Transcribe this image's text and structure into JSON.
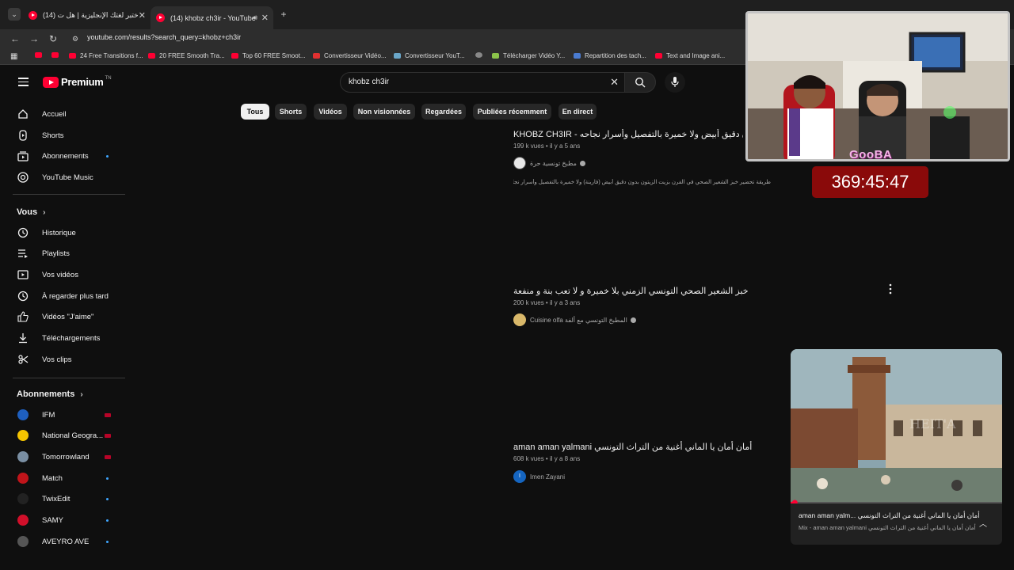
{
  "browser": {
    "tabs": [
      {
        "title": "(14) اختبر لغتك الإنجليزية | هل ت..."
      },
      {
        "title": "(14) khobz ch3ir - YouTube"
      }
    ],
    "url": "youtube.com/results?search_query=khobz+ch3ir",
    "bookmarks": [
      "24 Free Transitions f...",
      "20 FREE Smooth Tra...",
      "Top 60 FREE Smoot...",
      "Convertisseur Vidéo...",
      "Convertisseur YouT...",
      "Télécharger Vidéo Y...",
      "Repartition des tach...",
      "Text and Image ani..."
    ]
  },
  "youtube": {
    "logo_text": "Premium",
    "logo_badge": "TN",
    "search_value": "khobz ch3ir",
    "chips": [
      "Tous",
      "Shorts",
      "Vidéos",
      "Non visionnées",
      "Regardées",
      "Publiées récemment",
      "En direct"
    ],
    "active_chip": "Tous"
  },
  "sidebar": {
    "main": [
      {
        "label": "Accueil",
        "icon": "home-icon"
      },
      {
        "label": "Shorts",
        "icon": "shorts-icon"
      },
      {
        "label": "Abonnements",
        "icon": "subscriptions-icon"
      },
      {
        "label": "YouTube Music",
        "icon": "music-icon"
      }
    ],
    "vous_heading": "Vous",
    "vous": [
      {
        "label": "Historique",
        "icon": "history-icon"
      },
      {
        "label": "Playlists",
        "icon": "playlists-icon"
      },
      {
        "label": "Vos vidéos",
        "icon": "your-videos-icon"
      },
      {
        "label": "À regarder plus tard",
        "icon": "watch-later-icon"
      },
      {
        "label": "Vidéos \"J'aime\"",
        "icon": "like-icon"
      },
      {
        "label": "Téléchargements",
        "icon": "download-icon"
      },
      {
        "label": "Vos clips",
        "icon": "clips-icon"
      }
    ],
    "subs_heading": "Abonnements",
    "subs": [
      {
        "label": "IFM",
        "color": "#1e5fbf",
        "status": "live"
      },
      {
        "label": "National Geogra...",
        "color": "#f5c400",
        "status": "live"
      },
      {
        "label": "Tomorrowland",
        "color": "#7a8fa3",
        "status": "live"
      },
      {
        "label": "Match",
        "color": "#c0141a",
        "status": "new"
      },
      {
        "label": "TwixEdit",
        "color": "#222222",
        "status": "new"
      },
      {
        "label": "SAMY",
        "color": "#d10f2a",
        "status": "new"
      },
      {
        "label": "AVEYRO AVE",
        "color": "#555555",
        "status": "new"
      }
    ]
  },
  "results": [
    {
      "title": "KHOBZ CH3IR - خبز الشعير بدون دقيق أبيض ولا خميرة بالتفصيل وأسرار نجاحه",
      "views": "199 k vues",
      "age": "il y a 5 ans",
      "channel": "مطبخ تونسية حرة",
      "description": "طريقة تحضير خبز الشعير الصحي في الفرن بزيت الزيتون بدون دقيق أبيض (فارينة) ولا خميرة بالتفصيل وأسرار نجاحه ان ..."
    },
    {
      "title": "خبز الشعير الصحي التونسي الزمني بلا خميرة و لا تعب بنة و منفعة",
      "views": "200 k vues",
      "age": "il y a 3 ans",
      "channel": "Cuisine olfa المطبخ التونسي مع ألفة"
    },
    {
      "title": "aman aman yalmani أمان أمان يا الماني أغنية من التراث التونسي",
      "views": "608 k vues",
      "age": "il y a 8 ans",
      "channel": "Imen Zayani"
    }
  ],
  "overlay": {
    "streamer_tag": "GooBA",
    "timer": "369:45:47"
  },
  "miniplayer": {
    "title": "aman aman yalm... أمان أمان يا الماني أغنية من التراث التونسي",
    "subtitle": "Mix - aman aman yalmani أمان أمان يا الماني أغنية من التراث التونسي",
    "watermark": "HEIT'A",
    "progress_fraction": 0.02
  }
}
